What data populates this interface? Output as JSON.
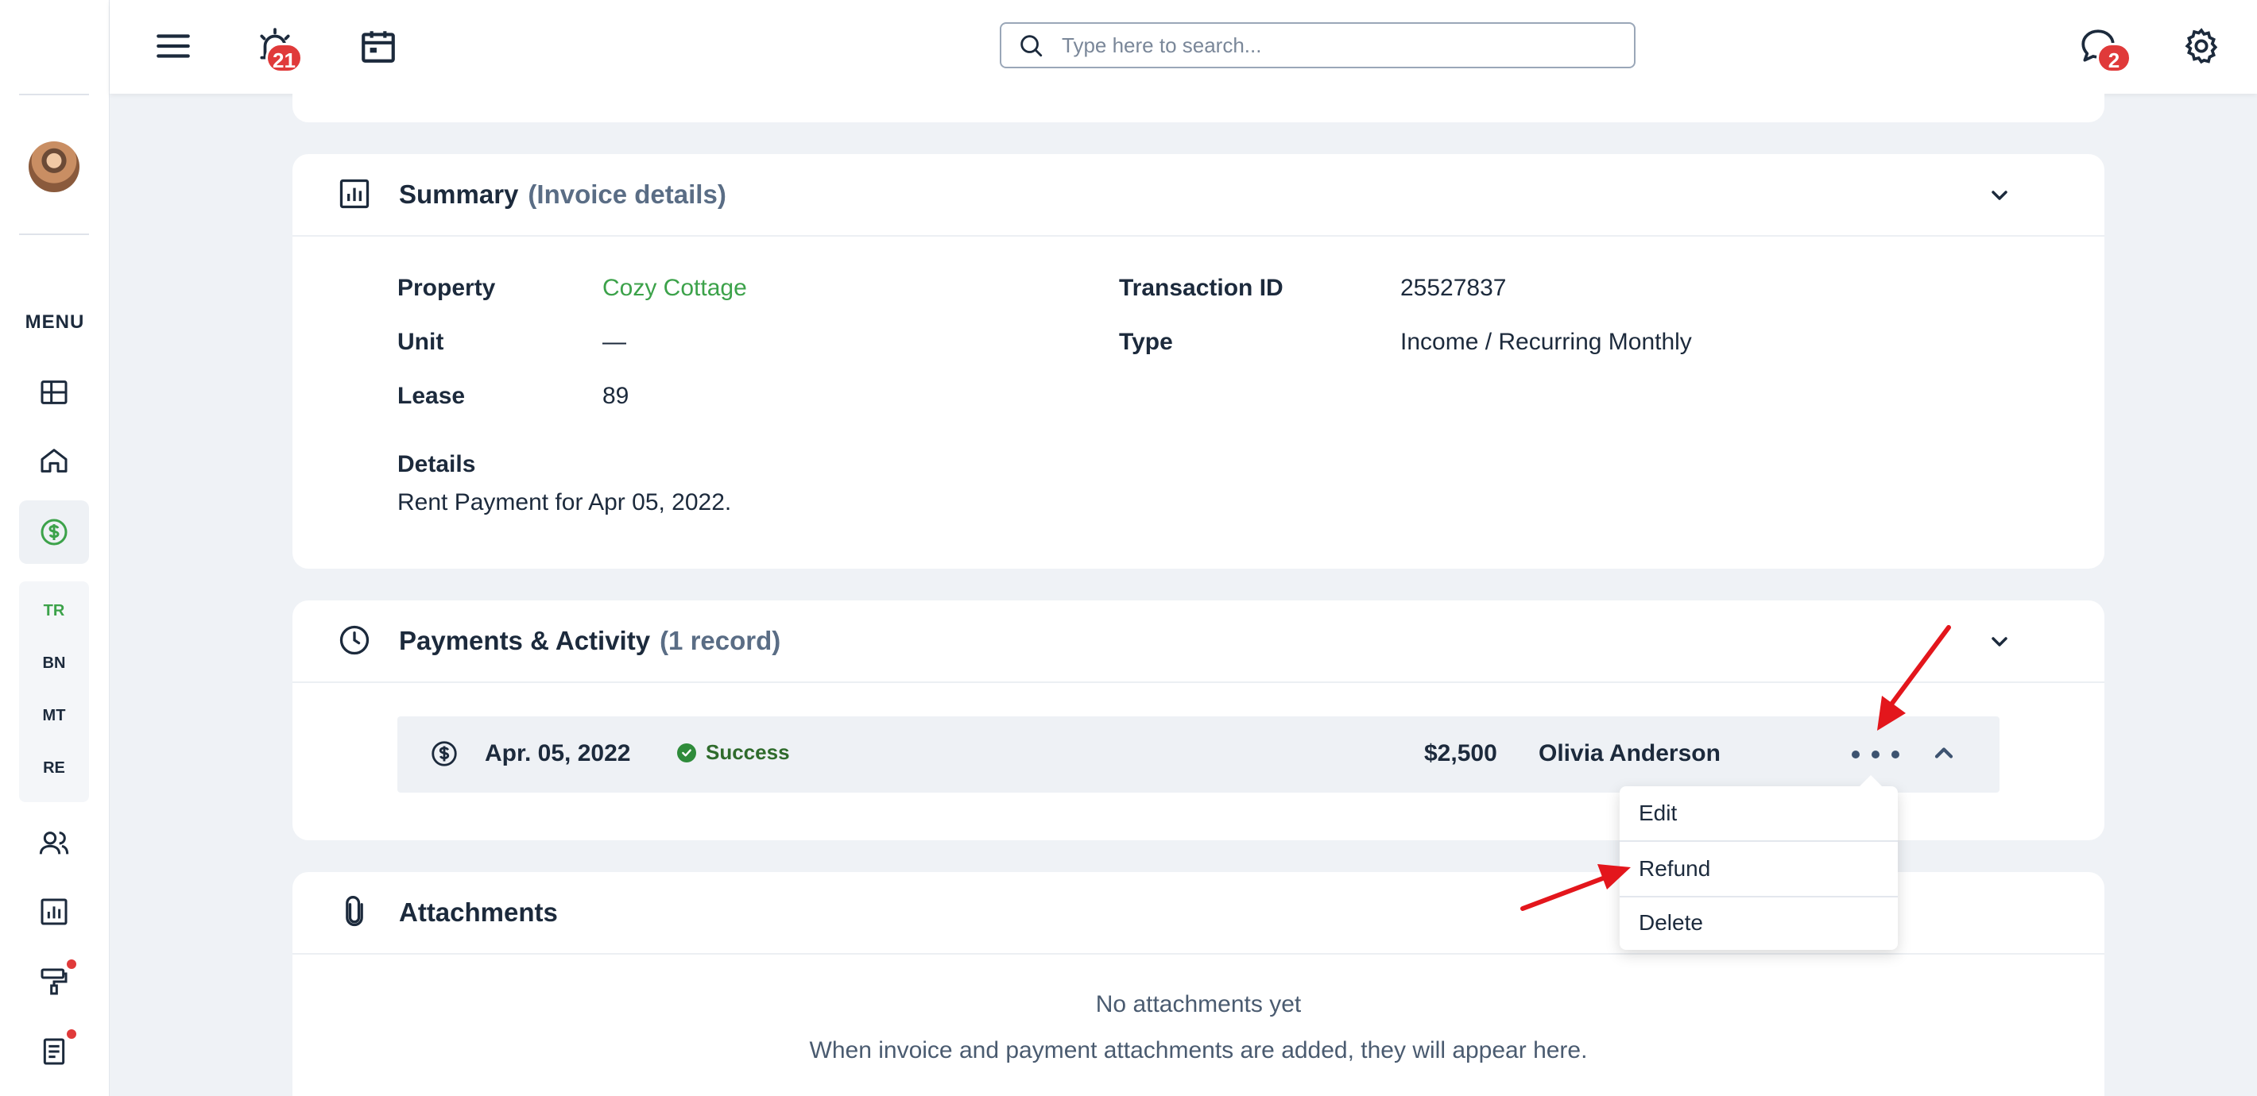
{
  "sidebar": {
    "menu_label": "MENU",
    "sub_items": [
      "TR",
      "BN",
      "MT",
      "RE"
    ]
  },
  "header": {
    "alerts_count": "21",
    "messages_count": "2",
    "search_placeholder": "Type here to search..."
  },
  "summary": {
    "title": "Summary",
    "subtitle": "(Invoice details)",
    "left": [
      {
        "label": "Property",
        "value": "Cozy Cottage"
      },
      {
        "label": "Unit",
        "value": "—"
      },
      {
        "label": "Lease",
        "value": "89"
      }
    ],
    "right": [
      {
        "label": "Transaction ID",
        "value": "25527837"
      },
      {
        "label": "Type",
        "value": "Income / Recurring Monthly"
      }
    ],
    "details_label": "Details",
    "details_value": "Rent Payment for Apr 05, 2022."
  },
  "payments": {
    "title": "Payments & Activity",
    "subtitle": "(1 record)",
    "row": {
      "date": "Apr. 05, 2022",
      "status": "Success",
      "amount": "$2,500",
      "payer": "Olivia Anderson"
    },
    "menu": [
      "Edit",
      "Refund",
      "Delete"
    ]
  },
  "attachments": {
    "title": "Attachments",
    "empty_title": "No attachments yet",
    "empty_desc": "When invoice and payment attachments are added, they will appear here."
  },
  "colors": {
    "accent_green": "#3ca24a",
    "badge_red": "#e03a3a",
    "arrow_red": "#e3161c"
  }
}
